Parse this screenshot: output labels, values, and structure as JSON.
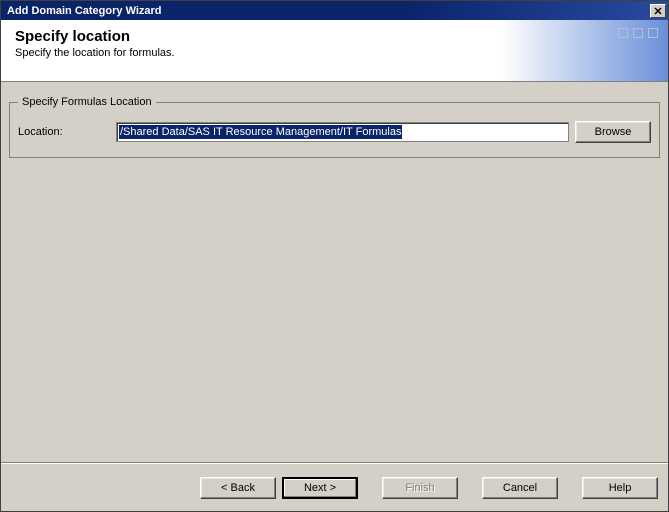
{
  "window": {
    "title": "Add Domain Category Wizard"
  },
  "header": {
    "title": "Specify location",
    "subtitle": "Specify the location for formulas."
  },
  "group": {
    "legend": "Specify Formulas Location",
    "location_label": "Location:",
    "location_value": "/Shared Data/SAS IT Resource Management/IT Formulas",
    "browse_label": "Browse"
  },
  "footer": {
    "back": "< Back",
    "next": "Next >",
    "finish": "Finish",
    "cancel": "Cancel",
    "help": "Help"
  }
}
